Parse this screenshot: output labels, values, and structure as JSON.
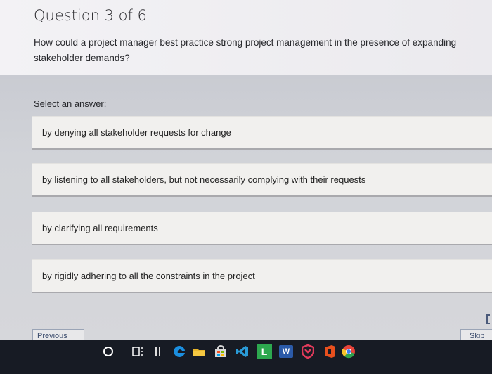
{
  "quiz": {
    "counter": "Question 3 of 6",
    "question": "How could a project manager best practice strong project management in the presence of expanding stakeholder demands?",
    "select_label": "Select an answer:",
    "answers": [
      "by denying all stakeholder requests for change",
      "by listening to all stakeholders, but not necessarily complying with their requests",
      "by clarifying all requirements",
      "by rigidly adhering to all the constraints in the project"
    ],
    "previous_label": "Previous",
    "skip_label": "Skip"
  },
  "taskbar": {
    "icons": [
      "search-circle-icon",
      "task-view-icon",
      "pause-icon",
      "edge-icon",
      "file-explorer-icon",
      "store-icon",
      "vscode-icon",
      "launcher-icon",
      "word-icon",
      "mcafee-shield-icon",
      "office-icon",
      "chrome-icon"
    ],
    "word_letter": "W",
    "launcher_letter": "L"
  }
}
